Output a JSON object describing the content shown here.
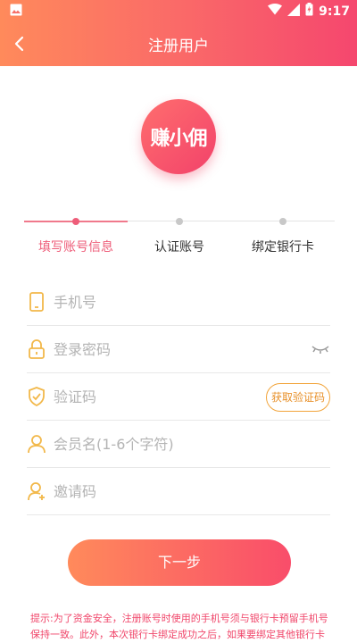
{
  "status_bar": {
    "time": "9:17"
  },
  "header": {
    "title": "注册用户"
  },
  "logo": {
    "text": "赚小佣"
  },
  "steps": [
    {
      "label": "填写账号信息",
      "active": true
    },
    {
      "label": "认证账号",
      "active": false
    },
    {
      "label": "绑定银行卡",
      "active": false
    }
  ],
  "form": {
    "phone": {
      "placeholder": "手机号",
      "value": ""
    },
    "password": {
      "placeholder": "登录密码",
      "value": ""
    },
    "code": {
      "placeholder": "验证码",
      "value": "",
      "button_label": "获取验证码"
    },
    "member_name": {
      "placeholder": "会员名(1-6个字符)",
      "value": ""
    },
    "invite": {
      "placeholder": "邀请码",
      "value": ""
    }
  },
  "next_button": {
    "label": "下一步"
  },
  "tip": {
    "text": "提示:为了资金安全，注册账号时使用的手机号须与银行卡预留手机号保持一致。此外，本次银行卡绑定成功之后，如果要绑定其他银行卡"
  },
  "colors": {
    "accent": "#f5476e",
    "accent_start": "#ff8a5b",
    "code_button": "#f2a43a",
    "icon": "#f2b84a"
  }
}
